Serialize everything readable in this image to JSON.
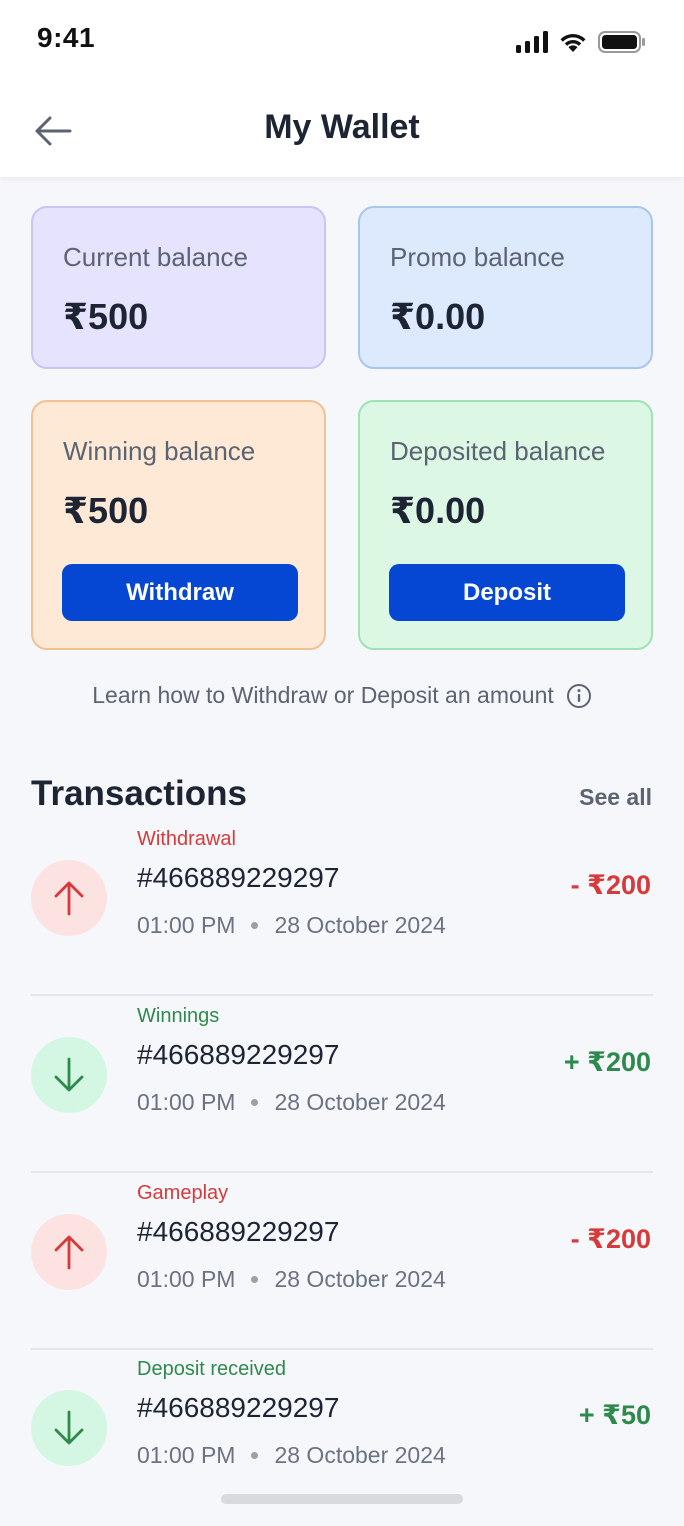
{
  "status_bar": {
    "time": "9:41"
  },
  "header": {
    "title": "My Wallet"
  },
  "balances": {
    "current": {
      "label": "Current balance",
      "amount": "₹500"
    },
    "promo": {
      "label": "Promo balance",
      "amount": "₹0.00"
    },
    "winning": {
      "label": "Winning balance",
      "amount": "₹500",
      "button": "Withdraw"
    },
    "deposited": {
      "label": "Deposited balance",
      "amount": "₹0.00",
      "button": "Deposit"
    }
  },
  "learn_text": "Learn how to Withdraw or Deposit an amount",
  "transactions": {
    "title": "Transactions",
    "see_all": "See all",
    "items": [
      {
        "type": "Withdrawal",
        "id": "#466889229297",
        "time": "01:00 PM",
        "date": "28 October 2024",
        "amount": "- ₹200",
        "direction": "out"
      },
      {
        "type": "Winnings",
        "id": "#466889229297",
        "time": "01:00 PM",
        "date": "28 October 2024",
        "amount": "+ ₹200",
        "direction": "in"
      },
      {
        "type": "Gameplay",
        "id": "#466889229297",
        "time": "01:00 PM",
        "date": "28 October 2024",
        "amount": "- ₹200",
        "direction": "out"
      },
      {
        "type": "Deposit received",
        "id": "#466889229297",
        "time": "01:00 PM",
        "date": "28 October 2024",
        "amount": "+ ₹50",
        "direction": "in"
      }
    ]
  },
  "colors": {
    "primary_button": "#0547d3",
    "debit": "#d63a3a",
    "credit": "#2e8a4c"
  }
}
